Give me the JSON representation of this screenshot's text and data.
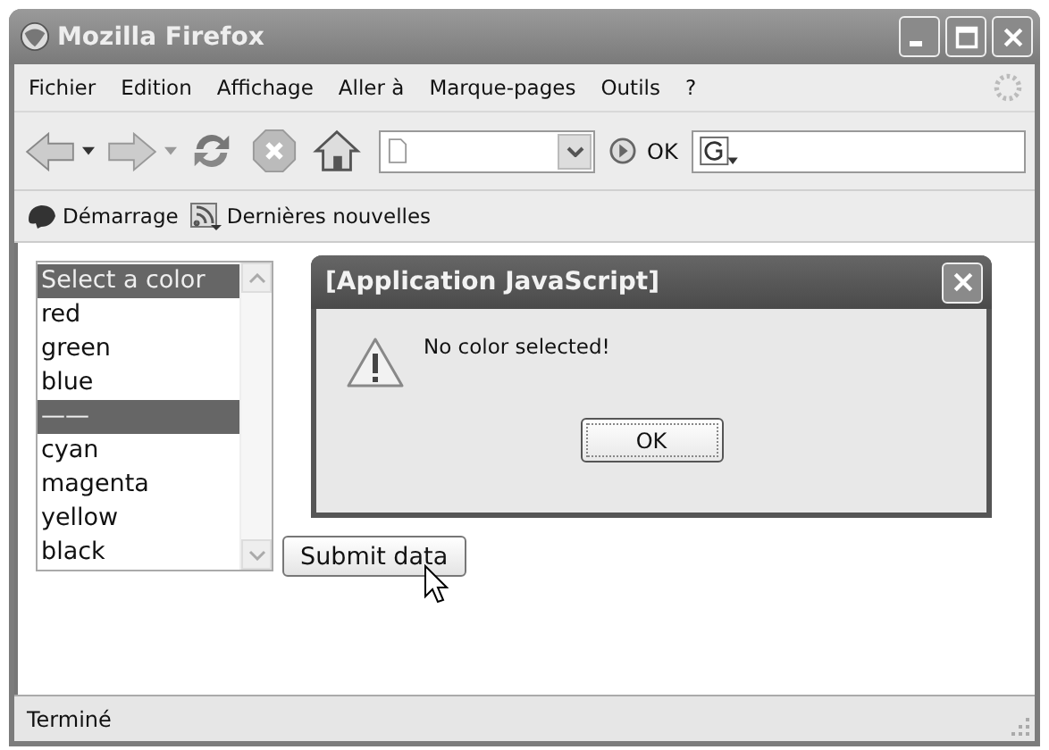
{
  "window": {
    "title": "Mozilla Firefox"
  },
  "menu": [
    "Fichier",
    "Edition",
    "Affichage",
    "Aller à",
    "Marque-pages",
    "Outils",
    "?"
  ],
  "navigation": {
    "go_label": "OK"
  },
  "bookmarks": [
    "Démarrage",
    "Dernières nouvelles"
  ],
  "listbox": {
    "options": [
      {
        "label": "Select a color",
        "selected": true
      },
      {
        "label": "red",
        "selected": false
      },
      {
        "label": "green",
        "selected": false
      },
      {
        "label": "blue",
        "selected": false
      },
      {
        "label": "——",
        "selected": true
      },
      {
        "label": "cyan",
        "selected": false
      },
      {
        "label": "magenta",
        "selected": false
      },
      {
        "label": "yellow",
        "selected": false
      },
      {
        "label": "black",
        "selected": false
      }
    ]
  },
  "submit_button": "Submit data",
  "dialog": {
    "title": "[Application JavaScript]",
    "message": "No color selected!",
    "button": "OK"
  },
  "status_bar": "Terminé"
}
